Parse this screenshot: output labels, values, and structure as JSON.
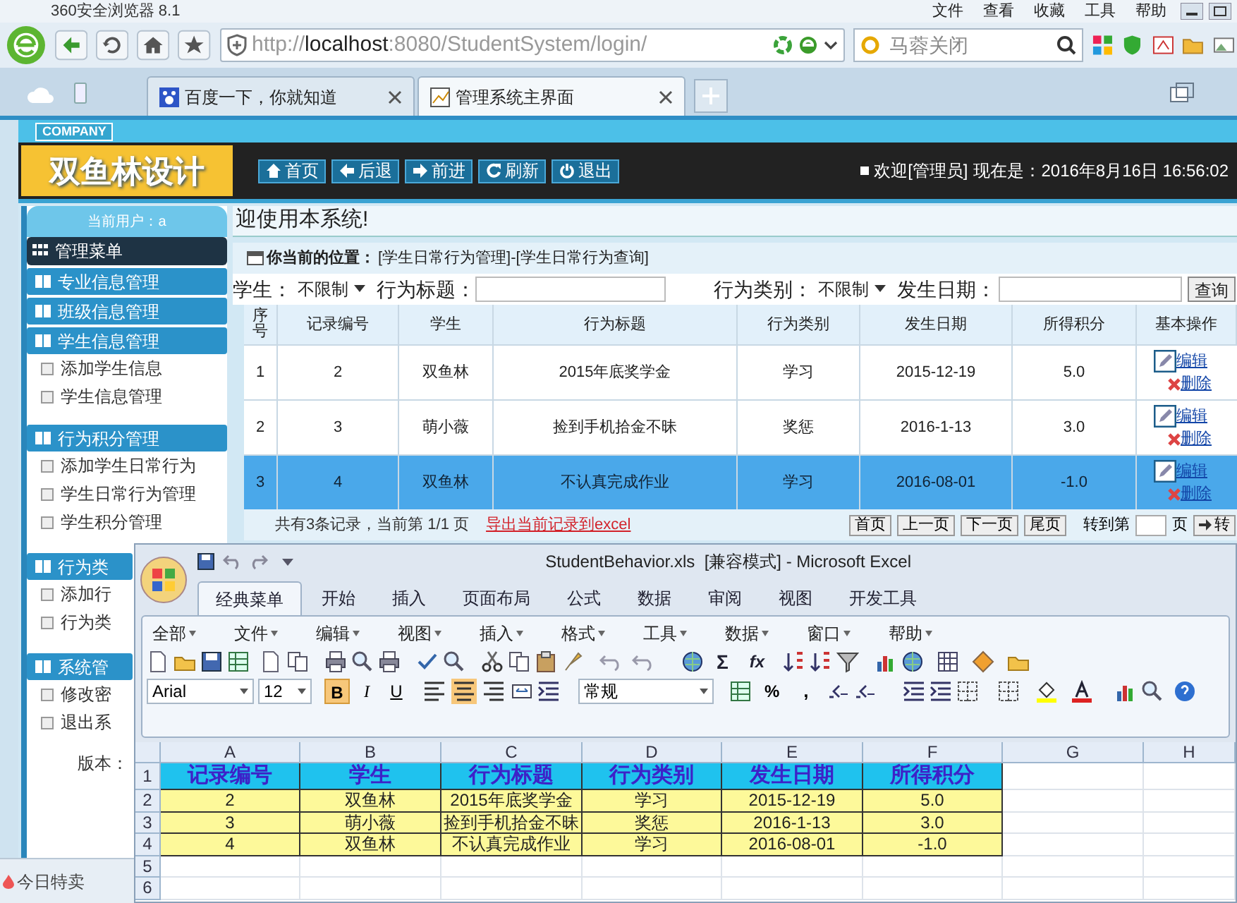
{
  "browser": {
    "title": "360安全浏览器 8.1",
    "menu": [
      "文件",
      "查看",
      "收藏",
      "工具",
      "帮助"
    ],
    "address": {
      "scheme": "http://",
      "host": "localhost",
      "rest": ":8080/StudentSystem/login/"
    },
    "search_value": "马蓉关闭",
    "tabs": [
      {
        "label": "百度一下，你就知道",
        "selected": false
      },
      {
        "label": "管理系统主界面",
        "selected": true
      }
    ],
    "status_item": "今日特卖"
  },
  "header": {
    "company": "COMPANY",
    "logo": "双鱼林设计",
    "nav": [
      "首页",
      "后退",
      "前进",
      "刷新",
      "退出"
    ],
    "welcome": "欢迎[管理员]",
    "clock": "现在是：2016年8月16日 16:56:02"
  },
  "sidebar": {
    "user": "当前用户：a",
    "menu_title": "管理菜单",
    "groups": [
      {
        "label": "专业信息管理"
      },
      {
        "label": "班级信息管理"
      },
      {
        "label": "学生信息管理",
        "children": [
          "添加学生信息",
          "学生信息管理"
        ]
      },
      {
        "label": "行为积分管理",
        "children": [
          "添加学生日常行为",
          "学生日常行为管理",
          "学生积分管理"
        ]
      },
      {
        "label": "行为类",
        "children": [
          "添加行",
          "行为类"
        ]
      },
      {
        "label": "系统管",
        "children": [
          "修改密",
          "退出系"
        ]
      }
    ],
    "version": "版本："
  },
  "content": {
    "welcome": "迎使用本系统!",
    "location_label": "你当前的位置：",
    "location_path": "[学生日常行为管理]-[学生日常行为查询]",
    "filters": [
      {
        "kind": "select",
        "label": "学生：",
        "value": "不限制"
      },
      {
        "kind": "input",
        "label": "行为标题："
      },
      {
        "kind": "select",
        "label": "行为类别：",
        "value": "不限制"
      },
      {
        "kind": "input",
        "label": "发生日期："
      }
    ],
    "query_button": "查询",
    "table": {
      "columns": [
        "序号",
        "记录编号",
        "学生",
        "行为标题",
        "行为类别",
        "发生日期",
        "所得积分",
        "基本操作"
      ],
      "rows": [
        {
          "selected": false,
          "cells": [
            "1",
            "2",
            "双鱼林",
            "2015年底奖学金",
            "学习",
            "2015-12-19",
            "5.0"
          ],
          "actions": [
            "编辑",
            "删除"
          ]
        },
        {
          "selected": false,
          "cells": [
            "2",
            "3",
            "萌小薇",
            "捡到手机拾金不昧",
            "奖惩",
            "2016-1-13",
            "3.0"
          ],
          "actions": [
            "编辑",
            "删除"
          ]
        },
        {
          "selected": true,
          "cells": [
            "3",
            "4",
            "双鱼林",
            "不认真完成作业",
            "学习",
            "2016-08-01",
            "-1.0"
          ],
          "actions": [
            "编辑",
            "删除"
          ]
        }
      ]
    },
    "summary": "共有3条记录，当前第 1/1 页",
    "export_link": "导出当前记录到excel",
    "pager": [
      "首页",
      "上一页",
      "下一页",
      "尾页"
    ],
    "goto_label": "转到第",
    "page_unit": "页",
    "goto_button": "转"
  },
  "excel": {
    "title": "StudentBehavior.xls  [兼容模式] - Microsoft Excel",
    "ribbon_tabs": [
      {
        "label": "经典菜单",
        "selected": true
      },
      {
        "label": "开始",
        "selected": false
      },
      {
        "label": "插入",
        "selected": false
      },
      {
        "label": "页面布局",
        "selected": false
      },
      {
        "label": "公式",
        "selected": false
      },
      {
        "label": "数据",
        "selected": false
      },
      {
        "label": "审阅",
        "selected": false
      },
      {
        "label": "视图",
        "selected": false
      },
      {
        "label": "开发工具",
        "selected": false
      }
    ],
    "menus": [
      "全部",
      "文件",
      "编辑",
      "视图",
      "插入",
      "格式",
      "工具",
      "数据",
      "窗口",
      "帮助"
    ],
    "font": "Arial",
    "size": "12",
    "format_buttons": [
      {
        "label": "B",
        "selected": true
      },
      {
        "label": "I",
        "selected": false
      },
      {
        "label": "U",
        "selected": false
      }
    ],
    "alignments": [
      {
        "selected": false
      },
      {
        "selected": true
      },
      {
        "selected": false
      }
    ],
    "number_format": "常规",
    "sum": "Σ",
    "function": "fx",
    "percent": "%",
    "comma": ",",
    "columns": [
      "A",
      "B",
      "C",
      "D",
      "E",
      "F",
      "G",
      "H"
    ],
    "row_numbers": [
      "1",
      "2",
      "3",
      "4",
      "5",
      "6"
    ],
    "rows": [
      {
        "kind": "header",
        "cells": [
          "记录编号",
          "学生",
          "行为标题",
          "行为类别",
          "发生日期",
          "所得积分"
        ]
      },
      {
        "kind": "data",
        "cells": [
          "2",
          "双鱼林",
          "2015年底奖学金",
          "学习",
          "2015-12-19",
          "5.0"
        ]
      },
      {
        "kind": "data",
        "cells": [
          "3",
          "萌小薇",
          "捡到手机拾金不昧",
          "奖惩",
          "2016-1-13",
          "3.0"
        ]
      },
      {
        "kind": "data",
        "cells": [
          "4",
          "双鱼林",
          "不认真完成作业",
          "学习",
          "2016-08-01",
          "-1.0"
        ]
      }
    ]
  }
}
